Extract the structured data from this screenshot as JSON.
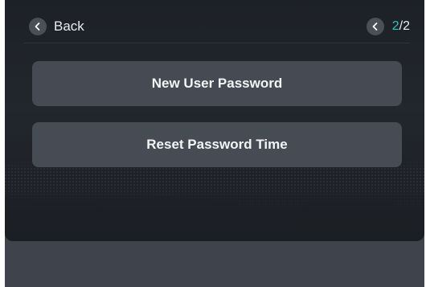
{
  "header": {
    "back_label": "Back",
    "page_current": "2",
    "page_separator": "/",
    "page_total": "2"
  },
  "menu": {
    "items": [
      {
        "label": "New User Password"
      },
      {
        "label": "Reset Password Time"
      }
    ]
  },
  "colors": {
    "accent": "#28c6b4",
    "panel_background": "#1f2329",
    "button_background": "#454a53",
    "outer_background": "#3f434c"
  },
  "icons": {
    "back": "chevron-left-icon",
    "page_prev": "chevron-left-icon"
  }
}
